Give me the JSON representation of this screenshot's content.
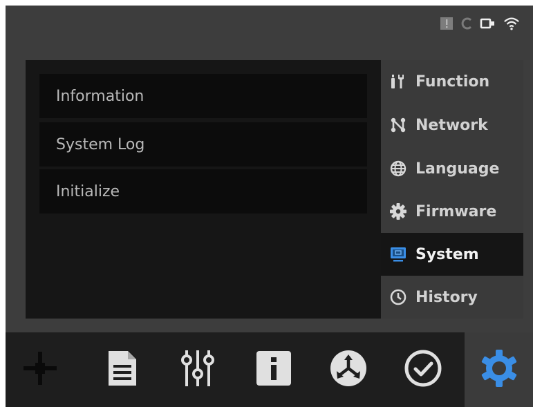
{
  "status_bar": {
    "icons": [
      "alert-icon",
      "sync-icon",
      "usb-icon",
      "wifi-icon"
    ]
  },
  "info_list": {
    "items": [
      {
        "label": "Information"
      },
      {
        "label": "System Log"
      },
      {
        "label": "Initialize"
      }
    ]
  },
  "side_menu": {
    "items": [
      {
        "label": "Function",
        "icon": "tools-icon",
        "active": false
      },
      {
        "label": "Network",
        "icon": "network-icon",
        "active": false
      },
      {
        "label": "Language",
        "icon": "globe-icon",
        "active": false
      },
      {
        "label": "Firmware",
        "icon": "firmware-gear-icon",
        "active": false
      },
      {
        "label": "System",
        "icon": "monitor-icon",
        "active": true
      },
      {
        "label": "History",
        "icon": "clock-icon",
        "active": false
      }
    ]
  },
  "bottom_tabs": {
    "items": [
      {
        "icon": "move-axes-icon",
        "active": false
      },
      {
        "icon": "document-icon",
        "active": false
      },
      {
        "icon": "sliders-icon",
        "active": false
      },
      {
        "icon": "info-icon",
        "active": false
      },
      {
        "icon": "tool-change-icon",
        "active": false
      },
      {
        "icon": "check-circle-icon",
        "active": false
      },
      {
        "icon": "settings-gear-icon",
        "active": true
      }
    ]
  },
  "colors": {
    "background": "#3d3d3d",
    "panel": "#161616",
    "list_item": "#0c0c0c",
    "active_item": "#151515",
    "bottom_bar": "#1e1e1e",
    "accent_blue": "#3a8ee6"
  }
}
